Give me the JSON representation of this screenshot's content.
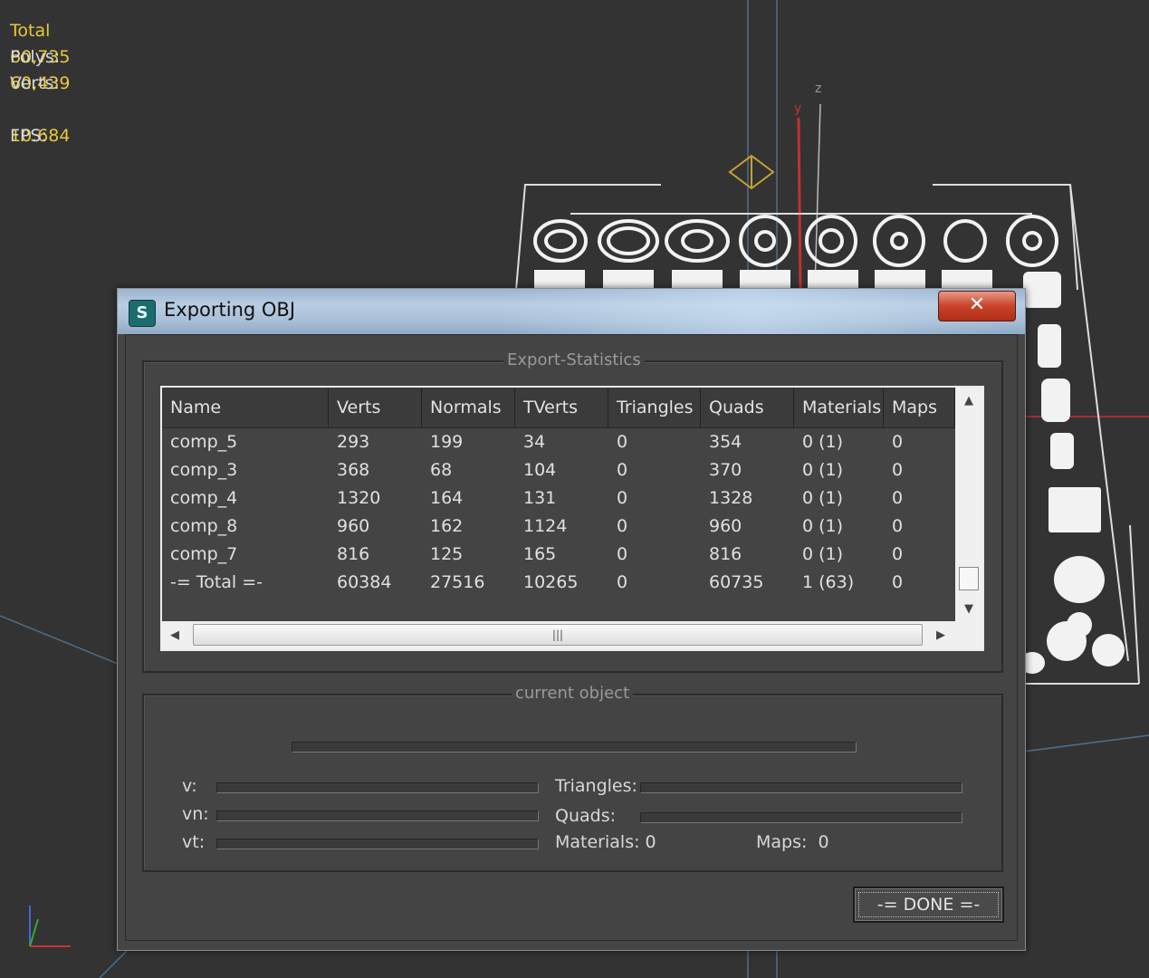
{
  "viewport_stats": {
    "header": "Total",
    "polys_label": "Polys:",
    "polys_value": "60,735",
    "verts_label": "Verts:",
    "verts_value": "60,439",
    "fps_label": "FPS:",
    "fps_value": "10.684"
  },
  "axis_labels": {
    "z": "z",
    "y": "y"
  },
  "dialog": {
    "title": "Exporting OBJ",
    "close_icon": "close-x-icon",
    "export_statistics_label": "Export-Statistics",
    "columns": [
      "Name",
      "Verts",
      "Normals",
      "TVerts",
      "Triangles",
      "Quads",
      "Materials",
      "Maps"
    ],
    "rows": [
      [
        "comp_5",
        "293",
        "199",
        "34",
        "0",
        "354",
        "0 (1)",
        "0"
      ],
      [
        "comp_3",
        "368",
        "68",
        "104",
        "0",
        "370",
        "0 (1)",
        "0"
      ],
      [
        "comp_4",
        "1320",
        "164",
        "131",
        "0",
        "1328",
        "0 (1)",
        "0"
      ],
      [
        "comp_8",
        "960",
        "162",
        "1124",
        "0",
        "960",
        "0 (1)",
        "0"
      ],
      [
        "comp_7",
        "816",
        "125",
        "165",
        "0",
        "816",
        "0 (1)",
        "0"
      ],
      [
        "-= Total =-",
        "60384",
        "27516",
        "10265",
        "0",
        "60735",
        "1 (63)",
        "0"
      ]
    ],
    "current_object_label": "current object",
    "v_label": "v:",
    "vn_label": "vn:",
    "vt_label": "vt:",
    "triangles_label": "Triangles:",
    "quads_label": "Quads:",
    "materials_label": "Materials: 0",
    "maps_label": "Maps:  0",
    "done_label": "-= DONE =-"
  }
}
